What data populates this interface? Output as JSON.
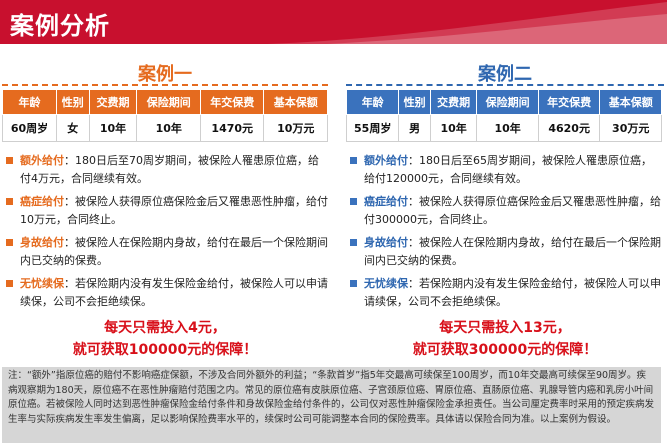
{
  "header": {
    "title": "案例分析"
  },
  "columns": [
    "年龄",
    "性别",
    "交费期",
    "保险期间",
    "年交保费",
    "基本保额"
  ],
  "case1": {
    "title": "案例一",
    "row": [
      "60周岁",
      "女",
      "10年",
      "10年",
      "1470元",
      "10万元"
    ],
    "items": [
      {
        "label": "额外给付",
        "text": "：180日后至70周岁期间，被保险人罹患原位癌，给付4万元，合同继续有效。"
      },
      {
        "label": "癌症给付",
        "text": "：被保险人获得原位癌保险金后又罹患恶性肿瘤，给付10万元，合同终止。"
      },
      {
        "label": "身故给付",
        "text": "：被保险人在保险期内身故，给付在最后一个保险期间内已交纳的保费。"
      },
      {
        "label": "无忧续保",
        "text": "：若保险期内没有发生保险金给付，被保险人可以申请续保，公司不会拒绝续保。"
      }
    ],
    "slogan_line1": "每天只需投入4元，",
    "slogan_line2": "就可获取100000元的保障！"
  },
  "case2": {
    "title": "案例二",
    "row": [
      "55周岁",
      "男",
      "10年",
      "10年",
      "4620元",
      "30万元"
    ],
    "items": [
      {
        "label": "额外给付",
        "text": "：180日后至65周岁期间，被保险人罹患原位癌，给付120000元，合同继续有效。"
      },
      {
        "label": "癌症给付",
        "text": "：被保险人获得原位癌保险金后又罹患恶性肿瘤，给付300000元，合同终止。"
      },
      {
        "label": "身故给付",
        "text": "：被保险人在保险期内身故，给付在最后一个保险期间内已交纳的保费。"
      },
      {
        "label": "无忧续保",
        "text": "：若保险期内没有发生保险金给付，被保险人可以申请续保，公司不会拒绝续保。"
      }
    ],
    "slogan_line1": "每天只需投入13元，",
    "slogan_line2": "就可获取300000元的保障！"
  },
  "note": "注：“额外”指原位癌的赔付不影响癌症保额，不涉及合同外额外的利益；“条款首岁”指5年交最高可续保至100周岁，而10年交最高可续保至90周岁。疾病观察期为180天，原位癌不在恶性肿瘤赔付范围之内。常见的原位癌有皮肤原位癌、子宫颈原位癌、胃原位癌、直肠原位癌、乳腺导管内癌和乳房小叶间原位癌。若被保险人同时达到恶性肿瘤保险金给付条件和身故保险金给付条件的，公司仅对恶性肿瘤保险金承担责任。当公司厘定费率时采用的预定疾病发生率与实际疾病发生率发生偏离，足以影响保险费率水平的，续保时公司可能调整本合同的保险费率。具体请以保险合同为准。以上案例为假设。",
  "colors": {
    "brand_red": "#c8102e",
    "case1_orange": "#e56b1f",
    "case2_blue": "#2f67b0",
    "slogan_red": "#d8101a"
  }
}
